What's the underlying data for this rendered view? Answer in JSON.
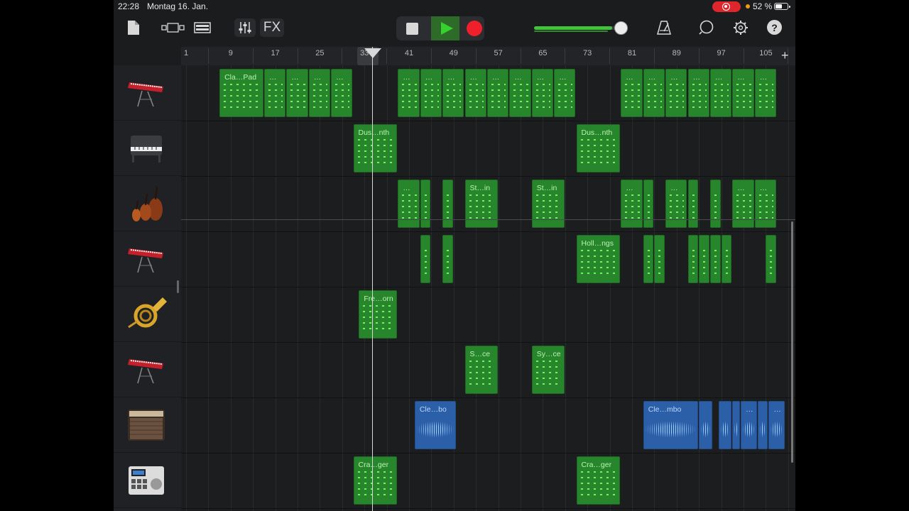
{
  "status_bar": {
    "time": "22:28",
    "date": "Montag 16. Jan.",
    "battery": "52 %"
  },
  "toolbar": {
    "fx_label": "FX"
  },
  "ruler": {
    "bars": [
      "1",
      "9",
      "17",
      "25",
      "33",
      "41",
      "49",
      "57",
      "65",
      "73",
      "81",
      "89",
      "97",
      "105"
    ]
  },
  "colors": {
    "midi_region": "#27852c",
    "audio_region": "#2b5fa8",
    "play": "#36d12f",
    "record": "#ef1f2b"
  },
  "tracks": [
    {
      "name": "keyboard",
      "icon": "red-synth-keyboard-icon",
      "regions": [
        {
          "label": "Cla…Pad",
          "start": 7,
          "end": 15,
          "type": "midi"
        },
        {
          "label": "…",
          "start": 15,
          "end": 19,
          "type": "midi"
        },
        {
          "label": "…",
          "start": 19,
          "end": 23,
          "type": "midi"
        },
        {
          "label": "…",
          "start": 23,
          "end": 27,
          "type": "midi"
        },
        {
          "label": "…",
          "start": 27,
          "end": 31,
          "type": "midi"
        },
        {
          "label": "…",
          "start": 39,
          "end": 43,
          "type": "midi"
        },
        {
          "label": "…",
          "start": 43,
          "end": 47,
          "type": "midi"
        },
        {
          "label": "…",
          "start": 47,
          "end": 51,
          "type": "midi"
        },
        {
          "label": "…",
          "start": 51,
          "end": 55,
          "type": "midi"
        },
        {
          "label": "…",
          "start": 55,
          "end": 59,
          "type": "midi"
        },
        {
          "label": "…",
          "start": 59,
          "end": 63,
          "type": "midi"
        },
        {
          "label": "…",
          "start": 63,
          "end": 67,
          "type": "midi"
        },
        {
          "label": "…",
          "start": 67,
          "end": 71,
          "type": "midi"
        },
        {
          "label": "…",
          "start": 79,
          "end": 83,
          "type": "midi"
        },
        {
          "label": "…",
          "start": 83,
          "end": 87,
          "type": "midi"
        },
        {
          "label": "…",
          "start": 87,
          "end": 91,
          "type": "midi"
        },
        {
          "label": "…",
          "start": 91,
          "end": 95,
          "type": "midi"
        },
        {
          "label": "…",
          "start": 95,
          "end": 99,
          "type": "midi"
        },
        {
          "label": "…",
          "start": 99,
          "end": 103,
          "type": "midi"
        },
        {
          "label": "…",
          "start": 103,
          "end": 107,
          "type": "midi"
        }
      ]
    },
    {
      "name": "piano",
      "icon": "upright-piano-icon",
      "regions": [
        {
          "label": "Dus…nth",
          "start": 31,
          "end": 39,
          "type": "midi"
        },
        {
          "label": "Dus…nth",
          "start": 71,
          "end": 79,
          "type": "midi"
        }
      ]
    },
    {
      "name": "strings",
      "icon": "string-ensemble-icon",
      "regions": [
        {
          "label": "…",
          "start": 39,
          "end": 43,
          "type": "midi"
        },
        {
          "label": "",
          "start": 43,
          "end": 45,
          "type": "midi"
        },
        {
          "label": "",
          "start": 47,
          "end": 49,
          "type": "midi"
        },
        {
          "label": "St…in",
          "start": 51,
          "end": 57,
          "type": "midi"
        },
        {
          "label": "St…in",
          "start": 63,
          "end": 69,
          "type": "midi"
        },
        {
          "label": "…",
          "start": 79,
          "end": 83,
          "type": "midi"
        },
        {
          "label": "",
          "start": 83,
          "end": 85,
          "type": "midi"
        },
        {
          "label": "…",
          "start": 87,
          "end": 91,
          "type": "midi"
        },
        {
          "label": "",
          "start": 91,
          "end": 93,
          "type": "midi"
        },
        {
          "label": "",
          "start": 95,
          "end": 97,
          "type": "midi"
        },
        {
          "label": "…",
          "start": 99,
          "end": 103,
          "type": "midi"
        },
        {
          "label": "…",
          "start": 103,
          "end": 107,
          "type": "midi"
        }
      ]
    },
    {
      "name": "keyboard-2",
      "icon": "red-synth-keyboard-icon",
      "regions": [
        {
          "label": "",
          "start": 43,
          "end": 45,
          "type": "midi"
        },
        {
          "label": "",
          "start": 47,
          "end": 49,
          "type": "midi"
        },
        {
          "label": "Holl…ngs",
          "start": 71,
          "end": 79,
          "type": "midi"
        },
        {
          "label": "",
          "start": 83,
          "end": 85,
          "type": "midi"
        },
        {
          "label": "",
          "start": 85,
          "end": 87,
          "type": "midi"
        },
        {
          "label": "",
          "start": 91,
          "end": 93,
          "type": "midi"
        },
        {
          "label": "",
          "start": 93,
          "end": 95,
          "type": "midi"
        },
        {
          "label": "",
          "start": 95,
          "end": 97,
          "type": "midi"
        },
        {
          "label": "",
          "start": 97,
          "end": 99,
          "type": "midi"
        },
        {
          "label": "",
          "start": 105,
          "end": 107,
          "type": "midi"
        }
      ]
    },
    {
      "name": "horn",
      "icon": "french-horn-icon",
      "regions": [
        {
          "label": "Fre…orn",
          "start": 32,
          "end": 39,
          "type": "midi"
        }
      ]
    },
    {
      "name": "keyboard-3",
      "icon": "red-synth-keyboard-icon",
      "regions": [
        {
          "label": "S…ce",
          "start": 51,
          "end": 57,
          "type": "midi"
        },
        {
          "label": "Sy…ce",
          "start": 63,
          "end": 69,
          "type": "midi"
        }
      ]
    },
    {
      "name": "amp",
      "icon": "guitar-amp-icon",
      "regions": [
        {
          "label": "Cle…bo",
          "start": 42,
          "end": 49.5,
          "type": "audio"
        },
        {
          "label": "Cle…mbo",
          "start": 83,
          "end": 93,
          "type": "audio"
        },
        {
          "label": "",
          "start": 93,
          "end": 95.5,
          "type": "audio"
        },
        {
          "label": "",
          "start": 96.5,
          "end": 99,
          "type": "audio"
        },
        {
          "label": "",
          "start": 99,
          "end": 100.5,
          "type": "audio"
        },
        {
          "label": "…",
          "start": 100.5,
          "end": 103.5,
          "type": "audio"
        },
        {
          "label": "",
          "start": 103.5,
          "end": 105.5,
          "type": "audio"
        },
        {
          "label": "…",
          "start": 105.5,
          "end": 108.5,
          "type": "audio"
        }
      ]
    },
    {
      "name": "drum-machine",
      "icon": "drum-machine-icon",
      "regions": [
        {
          "label": "Cra…ger",
          "start": 31,
          "end": 39,
          "type": "midi"
        },
        {
          "label": "Cra…ger",
          "start": 71,
          "end": 79,
          "type": "midi"
        }
      ]
    }
  ]
}
